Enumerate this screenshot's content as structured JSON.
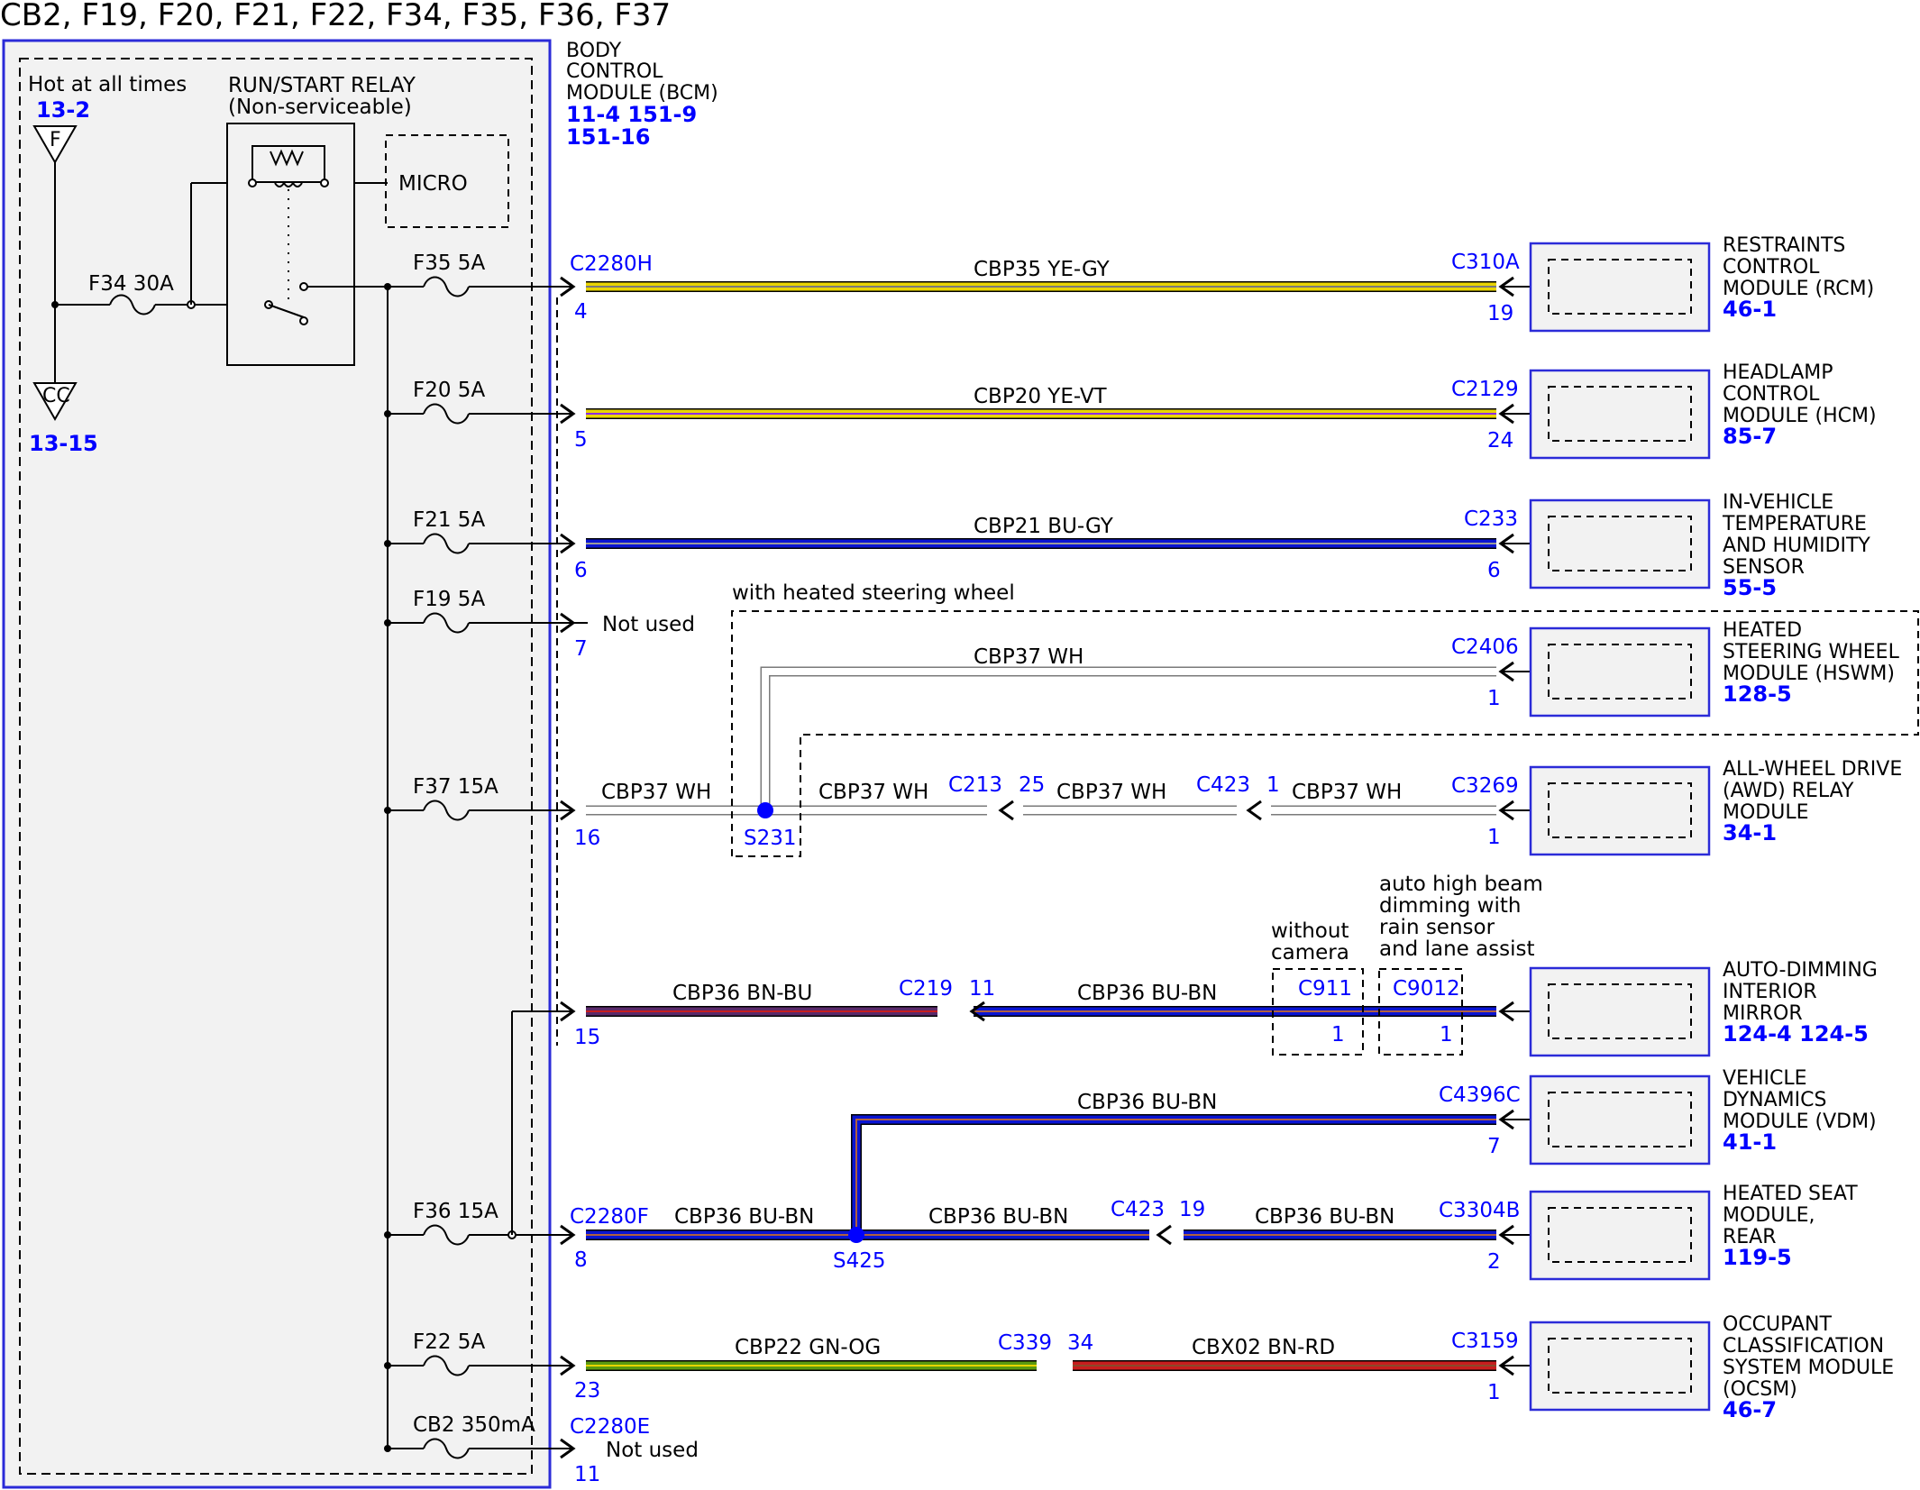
{
  "title": "CB2, F19, F20, F21, F22, F34, F35, F36, F37",
  "fuse_box": {
    "hot_label": "Hot at all times",
    "hot_ref": "13-2",
    "f_symbol": "F",
    "cc_symbol": "CC",
    "cc_ref": "13-15",
    "relay_label_1": "RUN/START RELAY",
    "relay_label_2": "(Non-serviceable)",
    "micro_label": "MICRO",
    "f34": "F34   30A",
    "fuses": [
      {
        "label": "F35   5A"
      },
      {
        "label": "F20   5A"
      },
      {
        "label": "F21   5A"
      },
      {
        "label": "F19   5A"
      },
      {
        "label": "F37   15A"
      },
      {
        "label": "F36   15A"
      },
      {
        "label": "F22   5A"
      },
      {
        "label": "CB2   350mA"
      }
    ]
  },
  "bcm": {
    "line1": "BODY",
    "line2": "CONTROL",
    "line3": "MODULE (BCM)",
    "ref1": "11-4   151-9",
    "ref2": "151-16",
    "connectors": [
      "C2280H",
      "C2280F",
      "C2280E"
    ],
    "pins": [
      "4",
      "5",
      "6",
      "7",
      "16",
      "15",
      "8",
      "23",
      "11"
    ],
    "not_used": "Not used"
  },
  "wires": [
    {
      "label": "CBP35   YE-GY"
    },
    {
      "label": "CBP20   YE-VT"
    },
    {
      "label": "CBP21   BU-GY"
    },
    {
      "label": "CBP37    WH"
    },
    {
      "label": "CBP37    WH"
    },
    {
      "label": "CBP37    WH"
    },
    {
      "label": "CBP37    WH"
    },
    {
      "label": "CBP37    WH"
    },
    {
      "label": "CBP36   BN-BU"
    },
    {
      "label": "CBP36   BU-BN"
    },
    {
      "label": "CBP36   BU-BN"
    },
    {
      "label": "CBP36   BU-BN"
    },
    {
      "label": "CBP36   BU-BN"
    },
    {
      "label": "CBP36   BU-BN"
    },
    {
      "label": "CBP22   GN-OG"
    },
    {
      "label": "CBX02     BN-RD"
    }
  ],
  "inline": [
    {
      "name": "C213",
      "pin": "25"
    },
    {
      "name": "C423",
      "pin": "1"
    },
    {
      "name": "C219",
      "pin": "11"
    },
    {
      "name": "C423",
      "pin": "19"
    },
    {
      "name": "C339",
      "pin": "34"
    }
  ],
  "splices": [
    "S231",
    "S425"
  ],
  "options": {
    "heated_wheel": "with heated steering wheel",
    "without_camera_1": "without",
    "without_camera_2": "camera",
    "auto_1": "auto high beam",
    "auto_2": "dimming with",
    "auto_3": "rain sensor",
    "auto_4": "and lane assist",
    "c911": "C911",
    "c9012": "C9012",
    "c911_pin": "1",
    "c9012_pin": "1"
  },
  "modules": [
    {
      "conn": "C310A",
      "pin": "19",
      "lines": [
        "RESTRAINTS",
        "CONTROL",
        "MODULE (RCM)"
      ],
      "ref": "46-1"
    },
    {
      "conn": "C2129",
      "pin": "24",
      "lines": [
        "HEADLAMP",
        "CONTROL",
        "MODULE (HCM)"
      ],
      "ref": "85-7"
    },
    {
      "conn": "C233",
      "pin": "6",
      "lines": [
        "IN-VEHICLE",
        "TEMPERATURE",
        "AND HUMIDITY",
        "SENSOR"
      ],
      "ref": "55-5"
    },
    {
      "conn": "C2406",
      "pin": "1",
      "lines": [
        "HEATED",
        "STEERING WHEEL",
        "MODULE (HSWM)"
      ],
      "ref": "128-5"
    },
    {
      "conn": "C3269",
      "pin": "1",
      "lines": [
        "ALL-WHEEL DRIVE",
        "(AWD) RELAY",
        "MODULE"
      ],
      "ref": "34-1"
    },
    {
      "conn": "",
      "pin": "",
      "lines": [
        "AUTO-DIMMING",
        "INTERIOR",
        "MIRROR"
      ],
      "ref": "124-4 124-5"
    },
    {
      "conn": "C4396C",
      "pin": "7",
      "lines": [
        "VEHICLE",
        "DYNAMICS",
        "MODULE (VDM)"
      ],
      "ref": "41-1"
    },
    {
      "conn": "C3304B",
      "pin": "2",
      "lines": [
        "HEATED SEAT",
        "MODULE,",
        "REAR"
      ],
      "ref": "119-5"
    },
    {
      "conn": "C3159",
      "pin": "1",
      "lines": [
        "OCCUPANT",
        "CLASSIFICATION",
        "SYSTEM MODULE",
        "(OCSM)"
      ],
      "ref": "46-7"
    }
  ],
  "colors": {
    "yellow": "#e8d400",
    "blue": "#0a14d2",
    "green": "#5a9a10",
    "red": "#c81e1e",
    "white_wire": "#ffffff",
    "border_blue": "#2b2bd8",
    "module_fill": "#f2f2f2"
  }
}
